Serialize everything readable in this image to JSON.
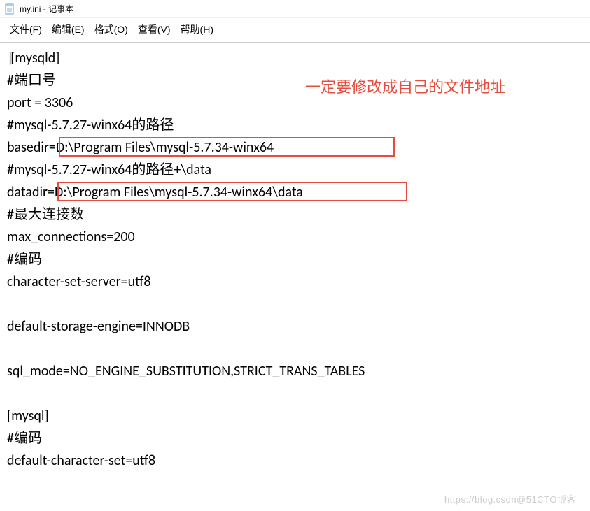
{
  "titlebar": {
    "title": "my.ini - 记事本"
  },
  "menubar": {
    "file": "文件(F)",
    "edit": "编辑(E)",
    "format": "格式(O)",
    "view": "查看(V)",
    "help": "帮助(H)"
  },
  "content": {
    "line1": "[mysqld]",
    "line2": "#端口号",
    "line3": "port = 3306",
    "line4": "#mysql-5.7.27-winx64的路径",
    "line5_prefix": "basedir=",
    "line5_path": "D:\\Program Files\\mysql-5.7.34-winx64",
    "line6": "#mysql-5.7.27-winx64的路径+\\data",
    "line7_prefix": "datadir=",
    "line7_path": "D:\\Program Files\\mysql-5.7.34-winx64\\data",
    "line8": "#最大连接数",
    "line9": "max_connections=200",
    "line10": "#编码",
    "line11": "character-set-server=utf8",
    "line12": "default-storage-engine=INNODB",
    "line13": "sql_mode=NO_ENGINE_SUBSTITUTION,STRICT_TRANS_TABLES",
    "line14": "[mysql]",
    "line15": "#编码",
    "line16": "default-character-set=utf8"
  },
  "annotation": {
    "text": "一定要修改成自己的文件地址"
  },
  "watermark": {
    "text": "https://blog.csdn@51CTO博客"
  }
}
